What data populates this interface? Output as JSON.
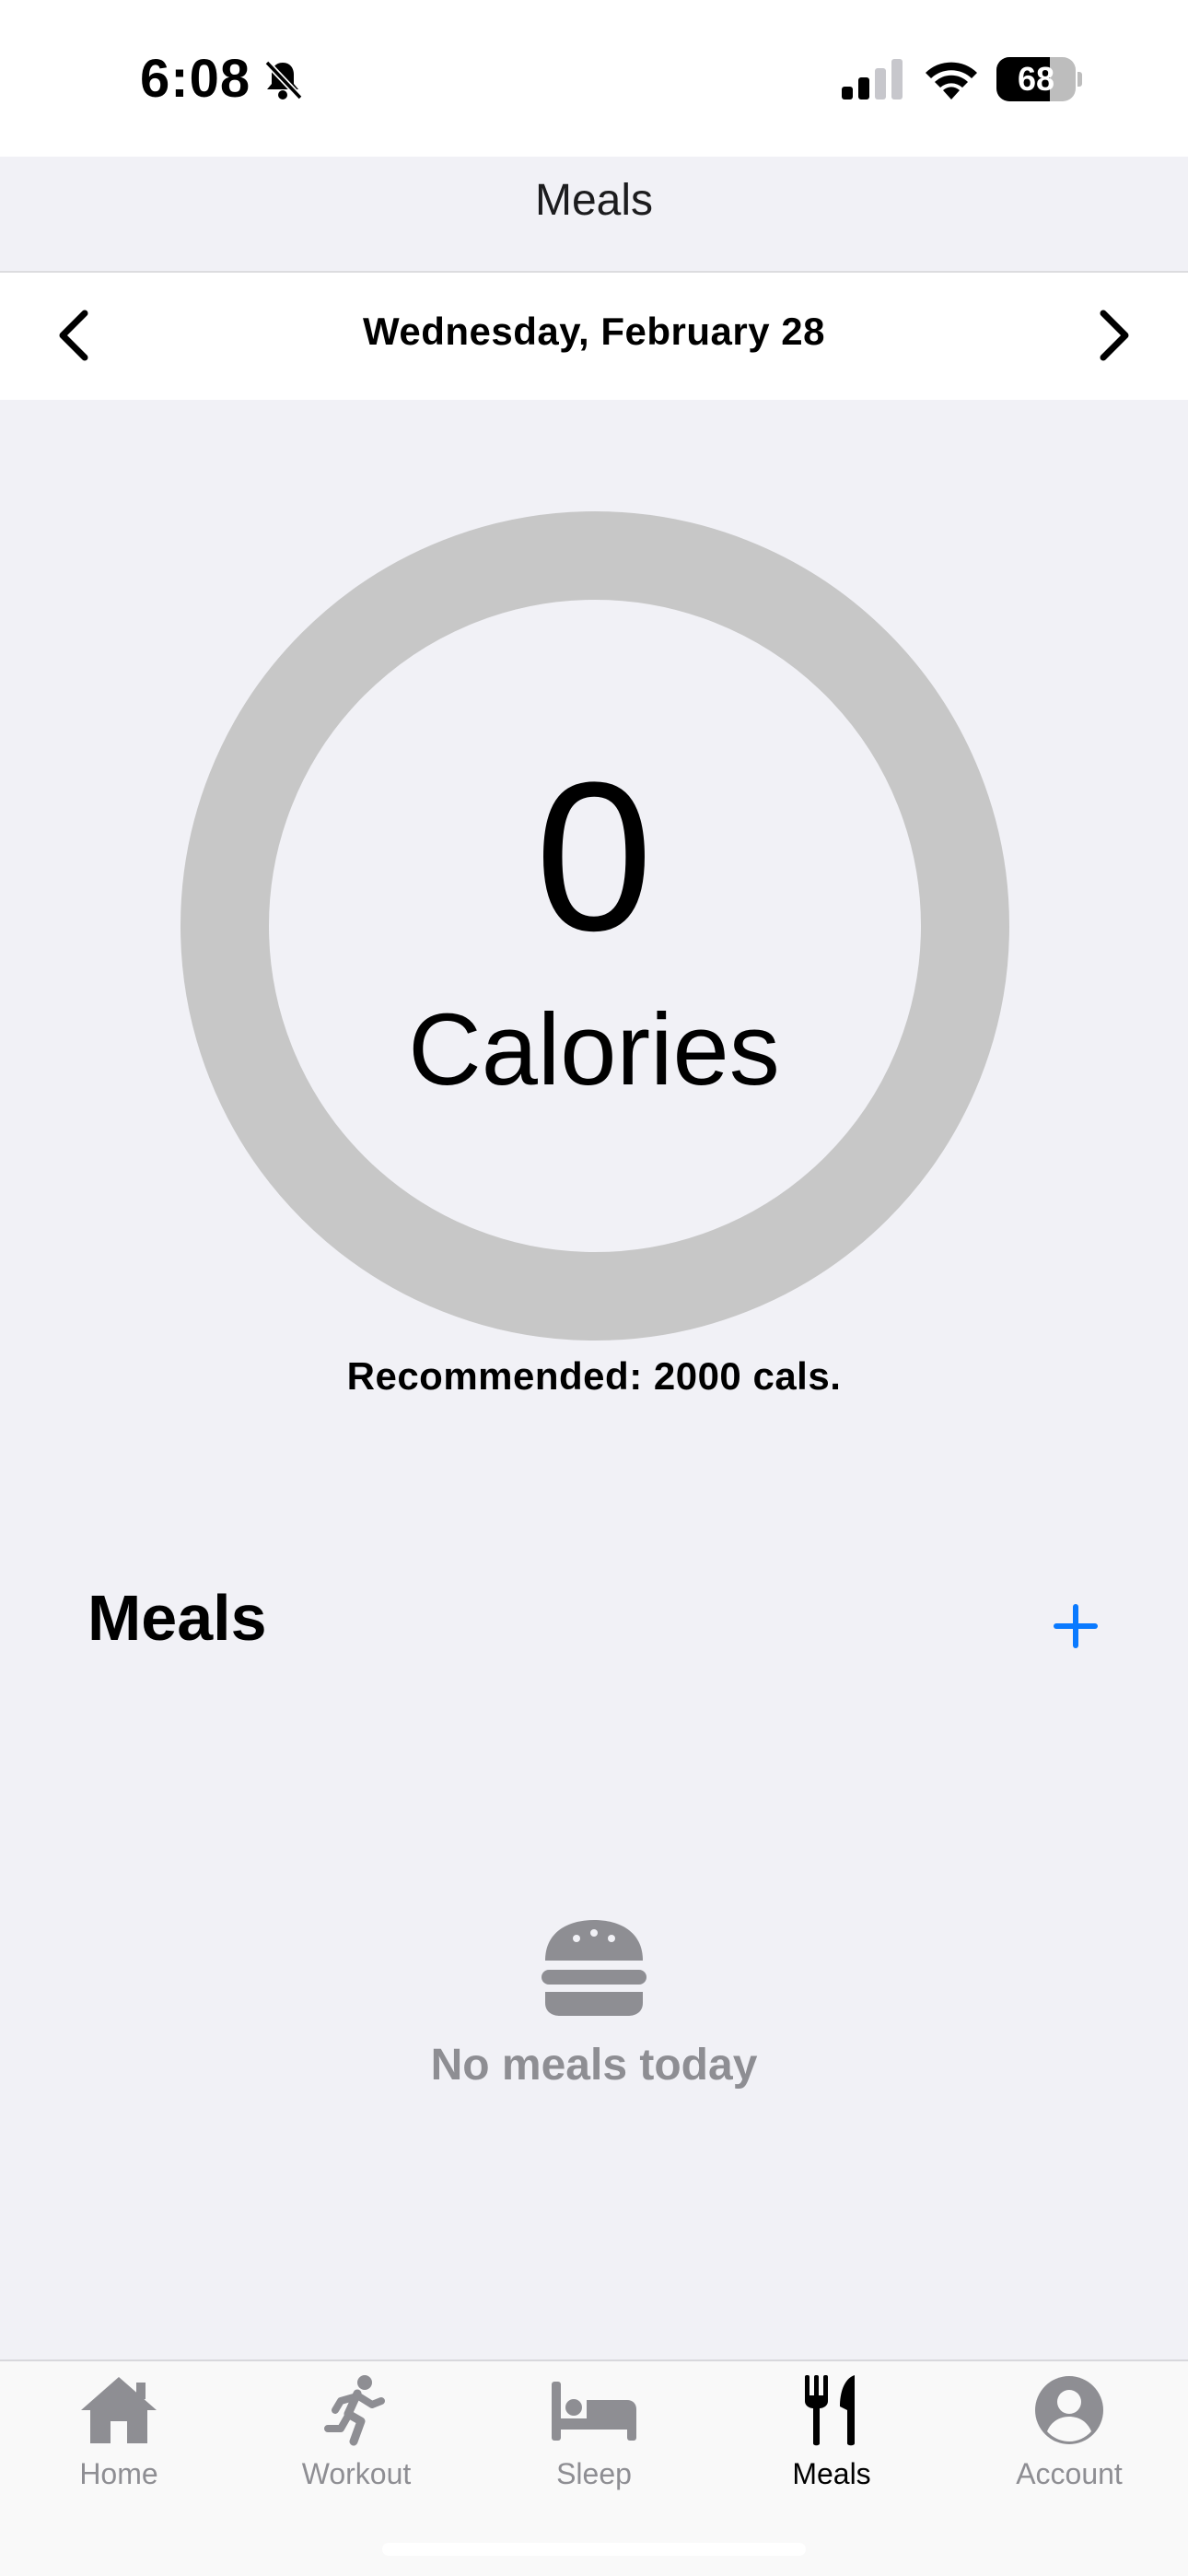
{
  "status_bar": {
    "time": "6:08",
    "battery_level": "68",
    "battery_fraction": 0.68,
    "icons": [
      "bell-slash-icon",
      "cellular-signal-icon",
      "wifi-icon",
      "battery-icon"
    ]
  },
  "nav": {
    "title": "Meals"
  },
  "date_bar": {
    "date": "Wednesday, February 28",
    "prev_icon": "chevron-left-icon",
    "next_icon": "chevron-right-icon"
  },
  "calories": {
    "value": "0",
    "label": "Calories",
    "progress_fraction": 0,
    "ring_color": "#c7c7c7",
    "recommended": "Recommended: 2000 cals."
  },
  "meals_section": {
    "title": "Meals",
    "add_icon": "plus-icon",
    "add_color": "#0a7aff",
    "empty_icon": "hamburger-icon",
    "empty_text": "No meals today"
  },
  "tab_bar": {
    "tabs": [
      {
        "label": "Home",
        "icon": "house-icon",
        "active": false
      },
      {
        "label": "Workout",
        "icon": "running-figure-icon",
        "active": false
      },
      {
        "label": "Sleep",
        "icon": "bed-icon",
        "active": false
      },
      {
        "label": "Meals",
        "icon": "fork-knife-icon",
        "active": true
      },
      {
        "label": "Account",
        "icon": "person-circle-icon",
        "active": false
      }
    ]
  }
}
